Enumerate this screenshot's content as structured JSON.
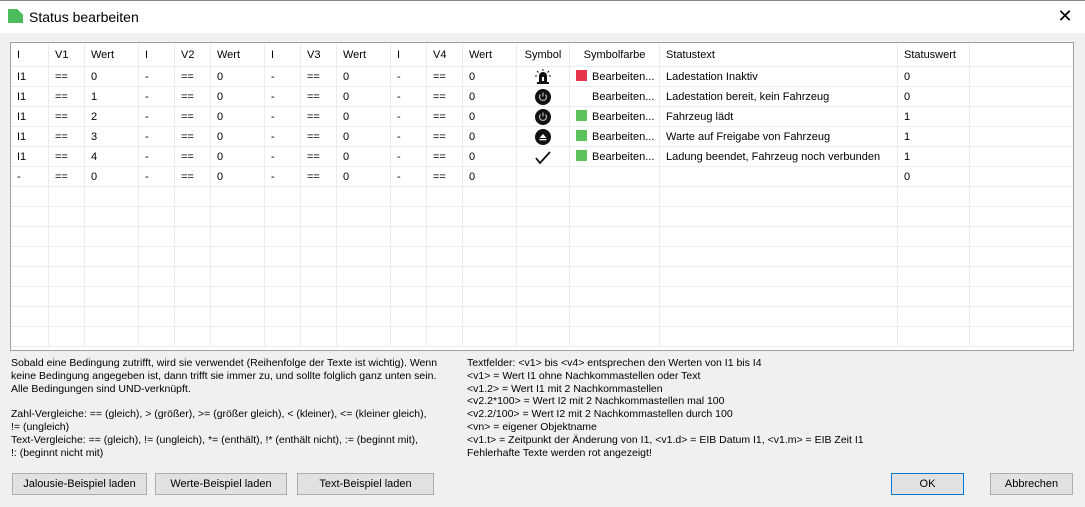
{
  "window": {
    "title": "Status bearbeiten"
  },
  "table": {
    "headers": [
      "I",
      "V1",
      "Wert",
      "I",
      "V2",
      "Wert",
      "I",
      "V3",
      "Wert",
      "I",
      "V4",
      "Wert",
      "Symbol",
      "Symbolfarbe",
      "Statustext",
      "Statuswert"
    ],
    "rows": [
      {
        "i1": "I1",
        "v1": "==",
        "w1": "0",
        "i2": "-",
        "v2": "==",
        "w2": "0",
        "i3": "-",
        "v3": "==",
        "w3": "0",
        "i4": "-",
        "v4": "==",
        "w4": "0",
        "symbol": "siren-icon",
        "color": "#e8344a",
        "color_label": "Bearbeiten...",
        "text": "Ladestation Inaktiv",
        "value": "0"
      },
      {
        "i1": "I1",
        "v1": "==",
        "w1": "1",
        "i2": "-",
        "v2": "==",
        "w2": "0",
        "i3": "-",
        "v3": "==",
        "w3": "0",
        "i4": "-",
        "v4": "==",
        "w4": "0",
        "symbol": "power-icon",
        "color": "",
        "color_label": "Bearbeiten...",
        "text": "Ladestation bereit, kein Fahrzeug",
        "value": "0"
      },
      {
        "i1": "I1",
        "v1": "==",
        "w1": "2",
        "i2": "-",
        "v2": "==",
        "w2": "0",
        "i3": "-",
        "v3": "==",
        "w3": "0",
        "i4": "-",
        "v4": "==",
        "w4": "0",
        "symbol": "power-icon",
        "color": "#5cc35c",
        "color_label": "Bearbeiten...",
        "text": "Fahrzeug lädt",
        "value": "1"
      },
      {
        "i1": "I1",
        "v1": "==",
        "w1": "3",
        "i2": "-",
        "v2": "==",
        "w2": "0",
        "i3": "-",
        "v3": "==",
        "w3": "0",
        "i4": "-",
        "v4": "==",
        "w4": "0",
        "symbol": "eject-icon",
        "color": "#5cc35c",
        "color_label": "Bearbeiten...",
        "text": "Warte auf Freigabe von Fahrzeug",
        "value": "1"
      },
      {
        "i1": "I1",
        "v1": "==",
        "w1": "4",
        "i2": "-",
        "v2": "==",
        "w2": "0",
        "i3": "-",
        "v3": "==",
        "w3": "0",
        "i4": "-",
        "v4": "==",
        "w4": "0",
        "symbol": "checkmark-icon",
        "color": "#5cc35c",
        "color_label": "Bearbeiten...",
        "text": "Ladung beendet, Fahrzeug noch verbunden",
        "value": "1"
      },
      {
        "i1": "-",
        "v1": "==",
        "w1": "0",
        "i2": "-",
        "v2": "==",
        "w2": "0",
        "i3": "-",
        "v3": "==",
        "w3": "0",
        "i4": "-",
        "v4": "==",
        "w4": "0",
        "symbol": "",
        "color": "",
        "color_label": "",
        "text": "",
        "value": "0"
      }
    ]
  },
  "help_left": "Sobald eine Bedingung zutrifft, wird sie verwendet (Reihenfolge der Texte ist wichtig). Wenn\nkeine Bedingung angegeben ist, dann trifft sie immer zu, und sollte folglich ganz unten sein.\nAlle Bedingungen sind UND-verknüpft.\n\nZahl-Vergleiche: == (gleich), > (größer), >= (größer gleich), < (kleiner), <= (kleiner gleich),\n!= (ungleich)\nText-Vergleiche: == (gleich), != (ungleich), *= (enthält), !* (enthält nicht), := (beginnt mit),\n!: (beginnt nicht mit)",
  "help_right": "Textfelder: <v1> bis <v4> entsprechen den Werten von I1 bis I4\n<v1> = Wert I1 ohne Nachkommastellen oder Text\n<v1.2> = Wert I1 mit 2 Nachkommastellen\n<v2.2*100> = Wert I2 mit 2 Nachkommastellen mal 100\n<v2.2/100> = Wert I2 mit 2 Nachkommastellen durch 100\n<vn> = eigener Objektname\n<v1.t> = Zeitpunkt der Änderung von I1, <v1.d> = EIB Datum I1, <v1.m> = EIB Zeit I1\nFehlerhafte Texte werden rot angezeigt!",
  "buttons": {
    "jalousie": "Jalousie-Beispiel laden",
    "werte": "Werte-Beispiel laden",
    "text": "Text-Beispiel laden",
    "ok": "OK",
    "cancel": "Abbrechen"
  }
}
